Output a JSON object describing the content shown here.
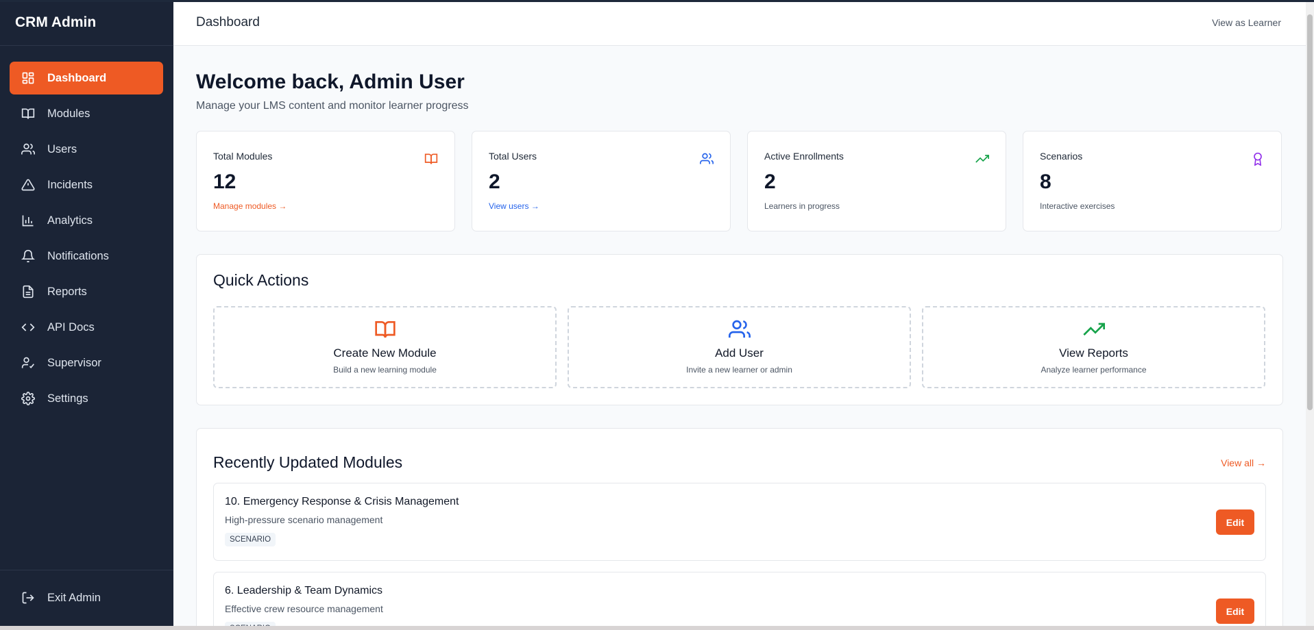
{
  "app": {
    "brand": "CRM Admin"
  },
  "sidebar": {
    "items": [
      {
        "label": "Dashboard",
        "icon": "dashboard-icon",
        "active": true
      },
      {
        "label": "Modules",
        "icon": "book-icon"
      },
      {
        "label": "Users",
        "icon": "users-icon"
      },
      {
        "label": "Incidents",
        "icon": "alert-triangle-icon"
      },
      {
        "label": "Analytics",
        "icon": "bar-chart-icon"
      },
      {
        "label": "Notifications",
        "icon": "bell-icon"
      },
      {
        "label": "Reports",
        "icon": "file-text-icon"
      },
      {
        "label": "API Docs",
        "icon": "code-icon"
      },
      {
        "label": "Supervisor",
        "icon": "user-check-icon"
      },
      {
        "label": "Settings",
        "icon": "gear-icon"
      }
    ],
    "exit_label": "Exit Admin"
  },
  "header": {
    "title": "Dashboard",
    "view_as_learner": "View as Learner"
  },
  "welcome": {
    "title": "Welcome back, Admin User",
    "subtitle": "Manage your LMS content and monitor learner progress"
  },
  "stats": [
    {
      "label": "Total Modules",
      "value": "12",
      "foot": "Manage modules →",
      "icon": "book-icon",
      "color": "#ee5a24"
    },
    {
      "label": "Total Users",
      "value": "2",
      "foot": "View users →",
      "icon": "users-icon",
      "color": "#2563eb"
    },
    {
      "label": "Active Enrollments",
      "value": "2",
      "foot": "Learners in progress",
      "icon": "trending-up-icon",
      "color": "#16a34a"
    },
    {
      "label": "Scenarios",
      "value": "8",
      "foot": "Interactive exercises",
      "icon": "award-icon",
      "color": "#9333ea"
    }
  ],
  "quick_actions": {
    "title": "Quick Actions",
    "items": [
      {
        "title": "Create New Module",
        "desc": "Build a new learning module",
        "icon": "book-icon",
        "color": "#ee5a24"
      },
      {
        "title": "Add User",
        "desc": "Invite a new learner or admin",
        "icon": "users-icon",
        "color": "#2563eb"
      },
      {
        "title": "View Reports",
        "desc": "Analyze learner performance",
        "icon": "trending-up-icon",
        "color": "#16a34a"
      }
    ]
  },
  "recent": {
    "title": "Recently Updated Modules",
    "view_all": "View all →",
    "edit_label": "Edit",
    "modules": [
      {
        "title": "10. Emergency Response & Crisis Management",
        "desc": "High-pressure scenario management",
        "tag": "SCENARIO"
      },
      {
        "title": "6. Leadership & Team Dynamics",
        "desc": "Effective crew resource management",
        "tag": "SCENARIO"
      }
    ]
  },
  "colors": {
    "accent": "#ee5a24",
    "sidebar_bg": "#1b2436"
  }
}
